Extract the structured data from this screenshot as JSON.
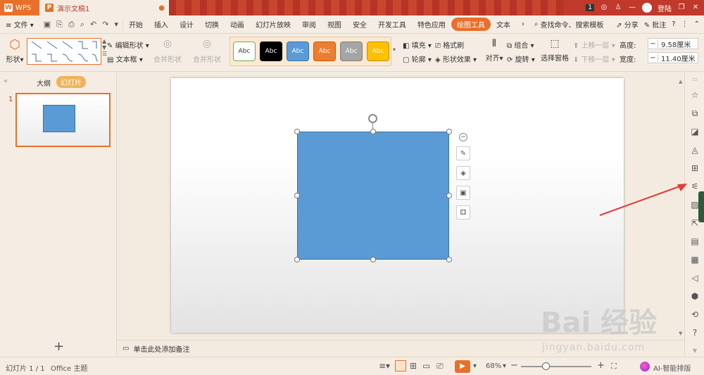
{
  "titlebar": {
    "wps_label": "WPS",
    "doc_tab": "演示文稿1",
    "badge": "1",
    "user_label": "登陆"
  },
  "menubar": {
    "file": "文件",
    "items": [
      "开始",
      "插入",
      "设计",
      "切换",
      "动画",
      "幻灯片放映",
      "审阅",
      "视图",
      "安全",
      "开发工具",
      "特色应用",
      "绘图工具",
      "文本"
    ],
    "active_index": 11,
    "search": "查找命令、搜索模板",
    "share": "分享",
    "comment": "批注"
  },
  "ribbon": {
    "shape_label": "形状",
    "edit_shape": "编辑形状",
    "textbox": "文本框",
    "merge_shape_a": "合并形状",
    "merge_shape_b": "合并形状",
    "styles": [
      {
        "label": "Abc",
        "bg": "#ffffff",
        "color": "#333333",
        "border": "#70ad47"
      },
      {
        "label": "Abc",
        "bg": "#000000",
        "color": "#ffffff",
        "border": "#000000"
      },
      {
        "label": "Abc",
        "bg": "#5b9bd5",
        "color": "#ffffff",
        "border": "#41719c"
      },
      {
        "label": "Abc",
        "bg": "#ed7d31",
        "color": "#ffffff",
        "border": "#c55a11"
      },
      {
        "label": "Abc",
        "bg": "#a5a5a5",
        "color": "#ffffff",
        "border": "#7f7f7f"
      },
      {
        "label": "Abc",
        "bg": "#ffc000",
        "color": "#ffffff",
        "border": "#bf9000"
      }
    ],
    "fill": "填充",
    "format_painter": "格式刷",
    "outline": "轮廓",
    "shape_effect": "形状效果",
    "align": "对齐",
    "group": "组合",
    "rotate": "旋转",
    "selection_pane": "选择窗格",
    "bring_forward": "上移一层",
    "send_backward": "下移一层",
    "height_label": "高度:",
    "height_value": "9.58厘米",
    "width_label": "宽度:",
    "width_value": "11.40厘米"
  },
  "left_panel": {
    "outline_tab": "大纲",
    "slides_tab": "幻灯片",
    "slide_number": "1"
  },
  "notes_placeholder": "单击此处添加备注",
  "statusbar": {
    "slide_info": "幻灯片 1 / 1",
    "theme": "Office 主题",
    "zoom": "68%",
    "ai_label": "AI-智能排版"
  },
  "watermark": {
    "big": "Bai 经验",
    "small": "jingyan.baidu.com"
  },
  "colors": {
    "accent": "#e8702a",
    "title_red": "#c0392b",
    "shape_fill": "#5b9bd5",
    "arrow": "#e53935"
  }
}
